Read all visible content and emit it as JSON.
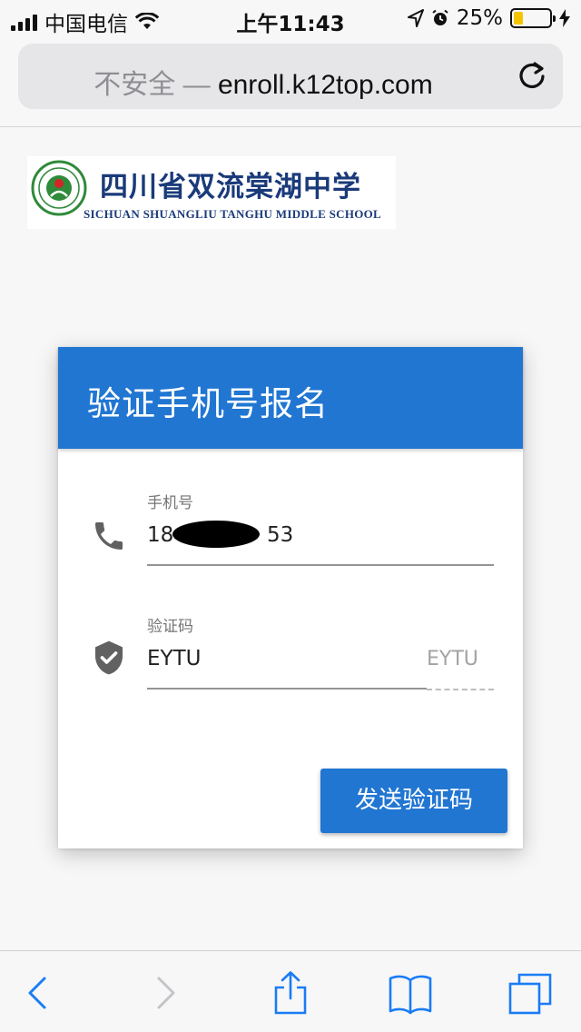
{
  "status_bar": {
    "carrier": "中国电信",
    "time": "上午11:43",
    "battery_percent": "25%",
    "battery_level": 0.25,
    "icons": [
      "signal-icon",
      "wifi-icon",
      "location-arrow-icon",
      "alarm-icon",
      "battery-icon",
      "charging-bolt-icon"
    ]
  },
  "address_bar": {
    "security": "不安全 —",
    "domain": "enroll.k12top.com",
    "reload_icon": "reload-icon"
  },
  "logo": {
    "chinese_name": "四川省双流棠湖中学",
    "english_name": "SICHUAN SHUANGLIU  TANGHU MIDDLE SCHOOL"
  },
  "form": {
    "title": "验证手机号报名",
    "phone": {
      "label": "手机号",
      "prefix": "18",
      "suffix": "53",
      "icon": "phone-icon"
    },
    "code": {
      "label": "验证码",
      "value": "EYTU",
      "captcha": "EYTU",
      "icon": "shield-check-icon"
    },
    "send_button": "发送验证码"
  },
  "toolbar": {
    "items": [
      "back-icon",
      "forward-icon",
      "share-icon",
      "bookmarks-icon",
      "tabs-icon"
    ]
  },
  "colors": {
    "primary": "#2176d2",
    "toolbar_blue": "#1a7cf5",
    "battery": "#f5c400"
  }
}
